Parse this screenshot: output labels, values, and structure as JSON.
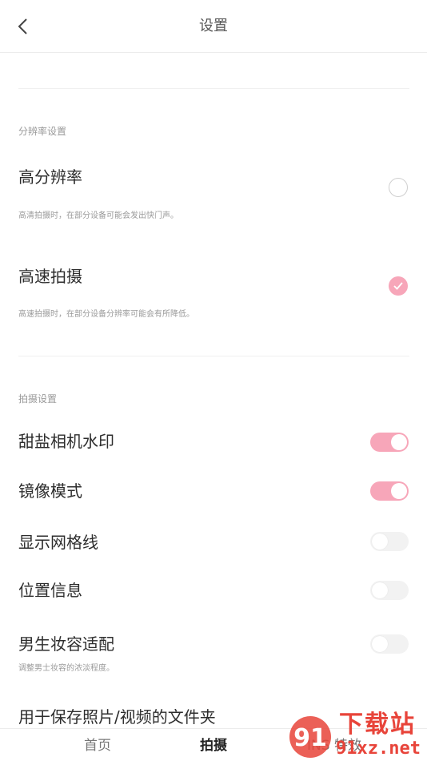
{
  "header": {
    "title": "设置"
  },
  "resolution_section": {
    "label": "分辨率设置",
    "options": [
      {
        "title": "高分辨率",
        "desc": "高清拍摄时，在部分设备可能会发出快门声。",
        "selected": false
      },
      {
        "title": "高速拍摄",
        "desc": "高速拍摄时，在部分设备分辨率可能会有所降低。",
        "selected": true
      }
    ]
  },
  "shooting_section": {
    "label": "拍摄设置",
    "toggles": [
      {
        "title": "甜盐相机水印",
        "on": true
      },
      {
        "title": "镜像模式",
        "on": true
      },
      {
        "title": "显示网格线",
        "on": false
      },
      {
        "title": "位置信息",
        "on": false
      },
      {
        "title": "男生妆容适配",
        "desc": "调整男士妆容的浓淡程度。",
        "on": false
      }
    ],
    "folder_label": "用于保存照片/视频的文件夹"
  },
  "bottom_nav": {
    "items": [
      {
        "label": "首页",
        "active": false
      },
      {
        "label": "拍摄",
        "active": true
      },
      {
        "label": "INS 特效",
        "active": false
      }
    ]
  },
  "watermark": {
    "text_top": "下载站",
    "text_bottom": "91xz.net",
    "logo": "91"
  },
  "colors": {
    "accent": "#f7a6b9",
    "toggle_off": "#f2f2f2",
    "text": "#2d2d2d",
    "secondary": "#9a9a9a"
  }
}
